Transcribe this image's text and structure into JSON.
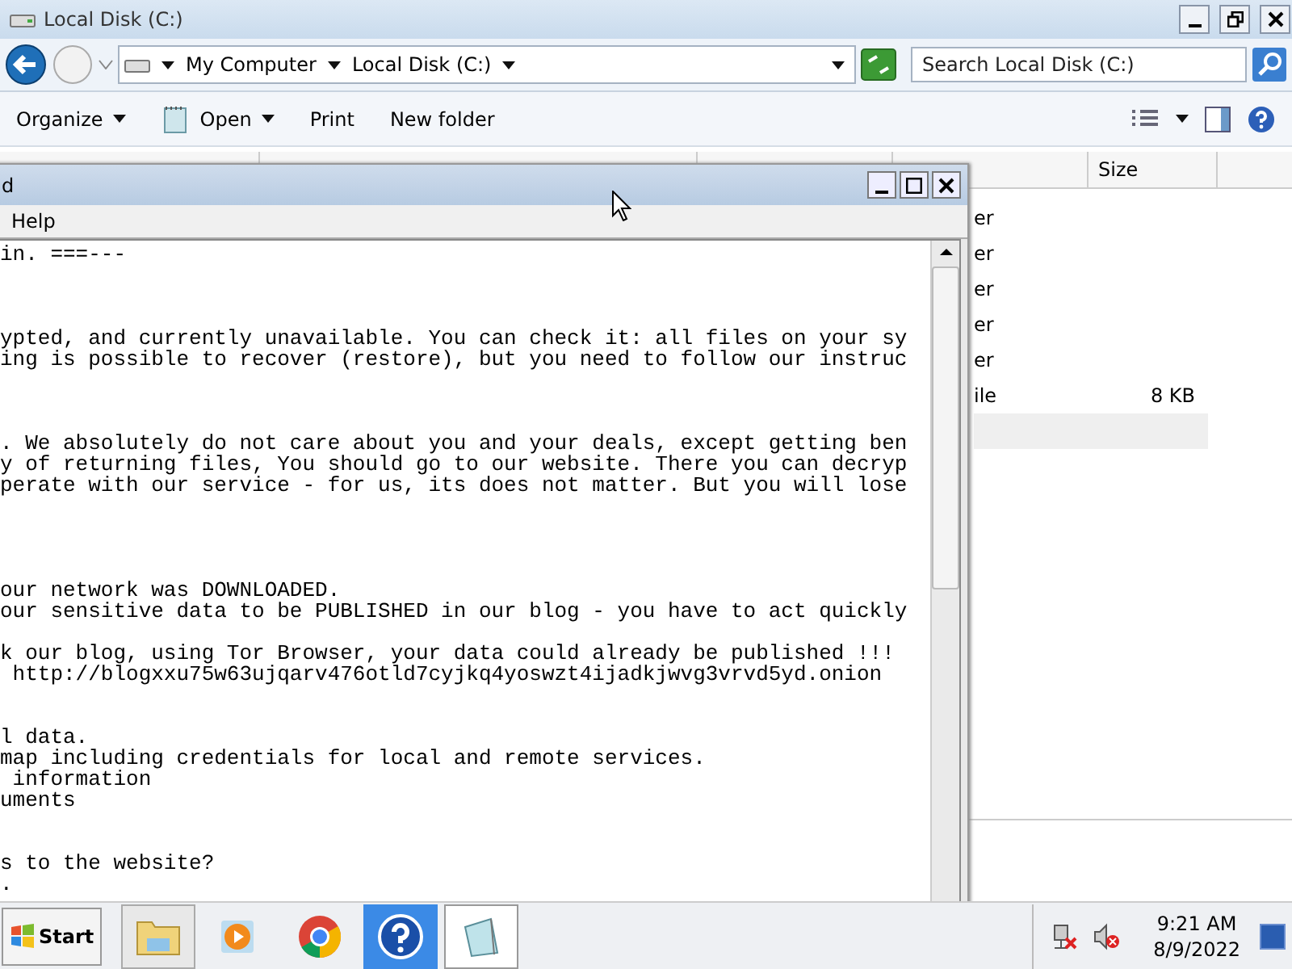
{
  "explorer": {
    "title": "Local Disk (C:)",
    "breadcrumb": [
      "My Computer",
      "Local Disk (C:)"
    ],
    "search": {
      "placeholder": "Search Local Disk (C:)"
    },
    "toolbar": [
      {
        "label": "Organize",
        "kind": "menu"
      },
      {
        "label": "Open",
        "kind": "split"
      },
      {
        "label": "Print",
        "kind": "plain"
      },
      {
        "label": "New folder",
        "kind": "plain"
      }
    ],
    "columns": [
      "Size"
    ],
    "rows": [
      {
        "name": "er",
        "selected": false
      },
      {
        "name": "er",
        "selected": false
      },
      {
        "name": "er",
        "selected": false
      },
      {
        "name": "er",
        "selected": false
      },
      {
        "name": "er",
        "selected": false
      },
      {
        "name": "ile",
        "size": "8 KB",
        "selected": false
      },
      {
        "selected": true
      }
    ]
  },
  "notepad": {
    "title": "d",
    "menu": [
      "Help"
    ],
    "text": "in. ===---\n\n\n\nypted, and currently unavailable. You can check it: all files on your sy\ning is possible to recover (restore), but you need to follow our instruc\n\n\n\n. We absolutely do not care about you and your deals, except getting ben\ny of returning files, You should go to our website. There you can decryp\nperate with our service - for us, its does not matter. But you will lose\n\n\n\n\nour network was DOWNLOADED.\nour sensitive data to be PUBLISHED in our blog - you have to act quickly\n\nk our blog, using Tor Browser, your data could already be published !!!\n http://blogxxu75w63ujqarv476otld7cyjkq4yoswzt4ijadkjwvg3vrvd5yd.onion\n\n\nl data.\nmap including credentials for local and remote services.\n information\numents\n\n\ns to the website?\n."
  },
  "taskbar": {
    "start": "Start",
    "apps": [
      {
        "kind": "folder",
        "selected": false
      },
      {
        "kind": "media",
        "selected": false
      },
      {
        "kind": "browser",
        "selected": false
      },
      {
        "kind": "help",
        "selected": false
      },
      {
        "kind": "notepad",
        "selected": true
      }
    ],
    "time": "9:21 AM",
    "date": "8/9/2022"
  }
}
